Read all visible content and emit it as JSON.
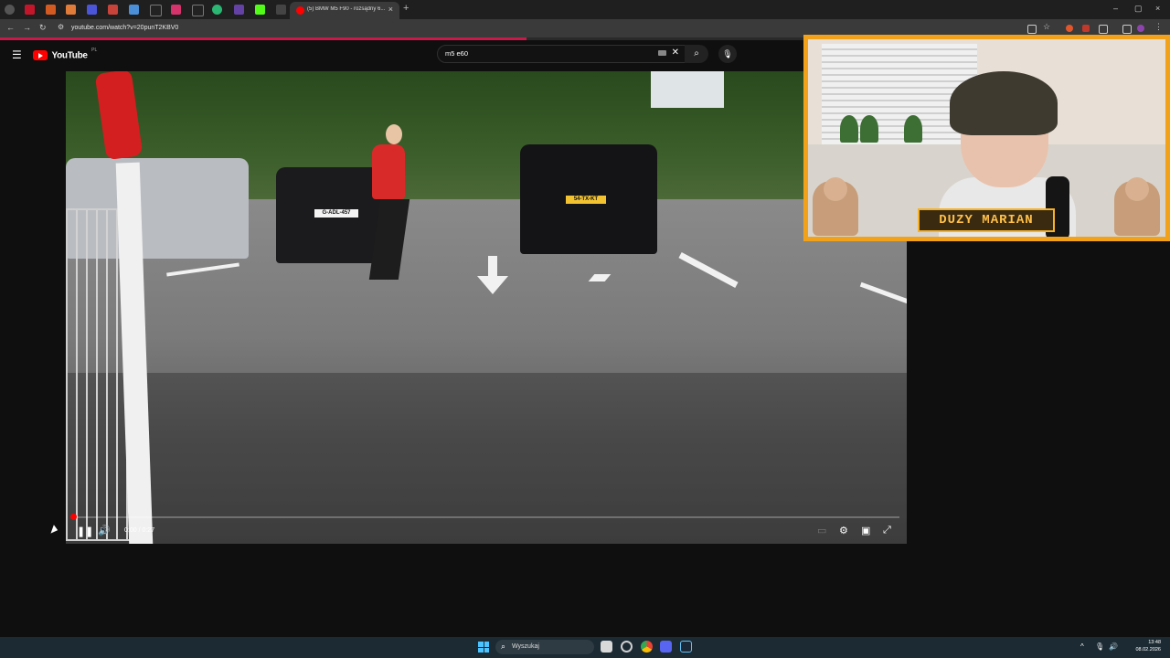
{
  "browser": {
    "active_tab_title": "(5) BMW M5 F90 - rozsądny 6...",
    "close_tab": "×",
    "new_tab": "+",
    "url": "youtube.com/watch?v=20punT2KBV0",
    "window_controls": [
      "–",
      "▢",
      "×"
    ],
    "nav": [
      "←",
      "→",
      "↻"
    ],
    "page_load_progress": 0.45
  },
  "youtube": {
    "menu_icon": "☰",
    "logo_text": "YouTube",
    "logo_region": "PL",
    "search_query": "m5 e60",
    "search_clear": "✕",
    "search_icon": "⌕",
    "mic_icon": "🎙"
  },
  "player": {
    "time": "0:00 / 0:27",
    "progress": 0.0,
    "pause_icon": "❚❚",
    "volume_icon": "🔊",
    "right_controls": [
      "▭",
      "⚙",
      "▣",
      "⤢"
    ]
  },
  "video_frame": {
    "left_plate": "G-ADL-457",
    "right_plate": "54-TX-KT"
  },
  "webcam": {
    "nameplate": "DUZY MARIAN"
  },
  "taskbar": {
    "search_placeholder": "Wyszukaj",
    "search_icon": "⌕",
    "time": "13:48",
    "date": "08.02.2026",
    "tray_icons": [
      "^",
      "🎙",
      "🔊"
    ]
  },
  "colors": {
    "youtube_red": "#ff0000",
    "webcam_frame": "#f2a11b",
    "taskbar": "#1b2a33"
  }
}
